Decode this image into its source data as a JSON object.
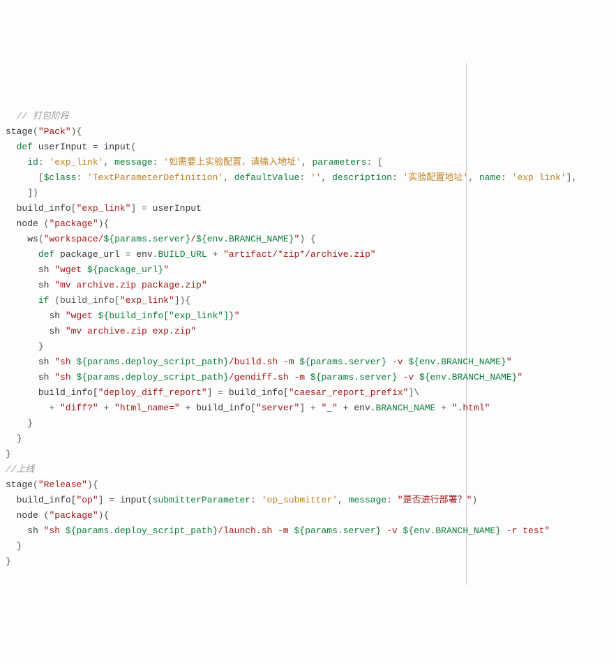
{
  "code": {
    "lines": [
      {
        "indent": 1,
        "parts": [
          {
            "t": "// 打包阶段",
            "c": "c-comment"
          }
        ]
      },
      {
        "indent": 0,
        "parts": [
          {
            "t": "stage",
            "c": "c-ident"
          },
          {
            "t": "(",
            "c": "c-punc"
          },
          {
            "t": "\"Pack\"",
            "c": "c-str"
          },
          {
            "t": "){",
            "c": "c-punc"
          }
        ]
      },
      {
        "indent": 1,
        "parts": [
          {
            "t": "def",
            "c": "c-kw"
          },
          {
            "t": " userInput ",
            "c": "c-ident"
          },
          {
            "t": "=",
            "c": "c-punc"
          },
          {
            "t": " input",
            "c": "c-ident"
          },
          {
            "t": "(",
            "c": "c-punc"
          }
        ]
      },
      {
        "indent": 2,
        "parts": [
          {
            "t": "id",
            "c": "c-param"
          },
          {
            "t": ": ",
            "c": "c-punc"
          },
          {
            "t": "'exp_link'",
            "c": "c-str2"
          },
          {
            "t": ", ",
            "c": "c-punc"
          },
          {
            "t": "message",
            "c": "c-param"
          },
          {
            "t": ": ",
            "c": "c-punc"
          },
          {
            "t": "'如需要上实验配置，请输入地址'",
            "c": "c-str2"
          },
          {
            "t": ", ",
            "c": "c-punc"
          },
          {
            "t": "parameters",
            "c": "c-param"
          },
          {
            "t": ": [",
            "c": "c-punc"
          }
        ]
      },
      {
        "indent": 3,
        "parts": [
          {
            "t": "[",
            "c": "c-punc"
          },
          {
            "t": "$class",
            "c": "c-param"
          },
          {
            "t": ": ",
            "c": "c-punc"
          },
          {
            "t": "'TextParameterDefinition'",
            "c": "c-str2"
          },
          {
            "t": ", ",
            "c": "c-punc"
          },
          {
            "t": "defaultValue",
            "c": "c-param"
          },
          {
            "t": ": ",
            "c": "c-punc"
          },
          {
            "t": "''",
            "c": "c-str2"
          },
          {
            "t": ", ",
            "c": "c-punc"
          },
          {
            "t": "description",
            "c": "c-param"
          },
          {
            "t": ": ",
            "c": "c-punc"
          },
          {
            "t": "'实验配置地址'",
            "c": "c-str2"
          },
          {
            "t": ", ",
            "c": "c-punc"
          },
          {
            "t": "name",
            "c": "c-param"
          },
          {
            "t": ": ",
            "c": "c-punc"
          },
          {
            "t": "'exp link'",
            "c": "c-str2"
          },
          {
            "t": "],",
            "c": "c-punc"
          }
        ]
      },
      {
        "indent": 2,
        "parts": [
          {
            "t": "])",
            "c": "c-punc"
          }
        ]
      },
      {
        "indent": 1,
        "parts": [
          {
            "t": "build_info",
            "c": "c-ident"
          },
          {
            "t": "[",
            "c": "c-punc"
          },
          {
            "t": "\"exp_link\"",
            "c": "c-str"
          },
          {
            "t": "] ",
            "c": "c-punc"
          },
          {
            "t": "=",
            "c": "c-punc"
          },
          {
            "t": " userInput",
            "c": "c-ident"
          }
        ]
      },
      {
        "indent": 1,
        "parts": [
          {
            "t": "node ",
            "c": "c-ident"
          },
          {
            "t": "(",
            "c": "c-punc"
          },
          {
            "t": "\"package\"",
            "c": "c-str"
          },
          {
            "t": "){",
            "c": "c-punc"
          }
        ]
      },
      {
        "indent": 2,
        "parts": [
          {
            "t": "ws",
            "c": "c-ident"
          },
          {
            "t": "(",
            "c": "c-punc"
          },
          {
            "t": "\"workspace/",
            "c": "c-str"
          },
          {
            "t": "${params.server}",
            "c": "c-interp"
          },
          {
            "t": "/",
            "c": "c-str"
          },
          {
            "t": "${env.BRANCH_NAME}",
            "c": "c-interp"
          },
          {
            "t": "\"",
            "c": "c-str"
          },
          {
            "t": ") {",
            "c": "c-punc"
          }
        ]
      },
      {
        "indent": 3,
        "parts": [
          {
            "t": "def",
            "c": "c-kw"
          },
          {
            "t": " package_url ",
            "c": "c-ident"
          },
          {
            "t": "=",
            "c": "c-punc"
          },
          {
            "t": " env",
            "c": "c-ident"
          },
          {
            "t": ".",
            "c": "c-punc"
          },
          {
            "t": "BUILD_URL",
            "c": "c-prop"
          },
          {
            "t": " + ",
            "c": "c-punc"
          },
          {
            "t": "\"artifact/*zip*/archive.zip\"",
            "c": "c-str"
          }
        ]
      },
      {
        "indent": 3,
        "parts": [
          {
            "t": "sh ",
            "c": "c-ident"
          },
          {
            "t": "\"wget ",
            "c": "c-str"
          },
          {
            "t": "${package_url}",
            "c": "c-interp"
          },
          {
            "t": "\"",
            "c": "c-str"
          }
        ]
      },
      {
        "indent": 3,
        "parts": [
          {
            "t": "sh ",
            "c": "c-ident"
          },
          {
            "t": "\"mv archive.zip package.zip\"",
            "c": "c-str"
          }
        ]
      },
      {
        "indent": 3,
        "parts": [
          {
            "t": "if",
            "c": "c-kw"
          },
          {
            "t": " (build_info[",
            "c": "c-punc"
          },
          {
            "t": "\"exp_link\"",
            "c": "c-str"
          },
          {
            "t": "]){",
            "c": "c-punc"
          }
        ]
      },
      {
        "indent": 4,
        "parts": [
          {
            "t": "sh ",
            "c": "c-ident"
          },
          {
            "t": "\"wget ",
            "c": "c-str"
          },
          {
            "t": "${build_info[\"exp_link\"]}",
            "c": "c-interp"
          },
          {
            "t": "\"",
            "c": "c-str"
          }
        ]
      },
      {
        "indent": 4,
        "parts": [
          {
            "t": "sh ",
            "c": "c-ident"
          },
          {
            "t": "\"mv archive.zip exp.zip\"",
            "c": "c-str"
          }
        ]
      },
      {
        "indent": 3,
        "parts": [
          {
            "t": "}",
            "c": "c-punc"
          }
        ]
      },
      {
        "indent": 3,
        "parts": [
          {
            "t": "sh ",
            "c": "c-ident"
          },
          {
            "t": "\"sh ",
            "c": "c-str"
          },
          {
            "t": "${params.deploy_script_path}",
            "c": "c-interp"
          },
          {
            "t": "/build.sh -m ",
            "c": "c-str"
          },
          {
            "t": "${params.server}",
            "c": "c-interp"
          },
          {
            "t": " -v ",
            "c": "c-str"
          },
          {
            "t": "${env.BRANCH_NAME}",
            "c": "c-interp"
          },
          {
            "t": "\"",
            "c": "c-str"
          }
        ]
      },
      {
        "indent": 3,
        "parts": [
          {
            "t": "sh ",
            "c": "c-ident"
          },
          {
            "t": "\"sh ",
            "c": "c-str"
          },
          {
            "t": "${params.deploy_script_path}",
            "c": "c-interp"
          },
          {
            "t": "/gendiff.sh -m ",
            "c": "c-str"
          },
          {
            "t": "${params.server}",
            "c": "c-interp"
          },
          {
            "t": " -v ",
            "c": "c-str"
          },
          {
            "t": "${env.BRANCH_NAME}",
            "c": "c-interp"
          },
          {
            "t": "\"",
            "c": "c-str"
          }
        ]
      },
      {
        "indent": 3,
        "parts": [
          {
            "t": "build_info[",
            "c": "c-ident"
          },
          {
            "t": "\"deploy_diff_report\"",
            "c": "c-str"
          },
          {
            "t": "] ",
            "c": "c-punc"
          },
          {
            "t": "=",
            "c": "c-punc"
          },
          {
            "t": " build_info[",
            "c": "c-ident"
          },
          {
            "t": "\"caesar_report_prefix\"",
            "c": "c-str"
          },
          {
            "t": "]\\",
            "c": "c-punc"
          }
        ]
      },
      {
        "indent": 4,
        "parts": [
          {
            "t": "+ ",
            "c": "c-punc"
          },
          {
            "t": "\"diff?\"",
            "c": "c-str"
          },
          {
            "t": " + ",
            "c": "c-punc"
          },
          {
            "t": "\"html_name=\"",
            "c": "c-str"
          },
          {
            "t": " + build_info[",
            "c": "c-ident"
          },
          {
            "t": "\"server\"",
            "c": "c-str"
          },
          {
            "t": "] + ",
            "c": "c-punc"
          },
          {
            "t": "\"_\"",
            "c": "c-str"
          },
          {
            "t": " + env.",
            "c": "c-ident"
          },
          {
            "t": "BRANCH_NAME",
            "c": "c-prop"
          },
          {
            "t": " + ",
            "c": "c-punc"
          },
          {
            "t": "\".html\"",
            "c": "c-str"
          }
        ]
      },
      {
        "indent": 2,
        "parts": [
          {
            "t": "}",
            "c": "c-punc"
          }
        ]
      },
      {
        "indent": 1,
        "parts": [
          {
            "t": "}",
            "c": "c-punc"
          }
        ]
      },
      {
        "indent": 0,
        "parts": [
          {
            "t": "}",
            "c": "c-punc"
          }
        ]
      },
      {
        "indent": 0,
        "parts": [
          {
            "t": "//上线",
            "c": "c-comment"
          }
        ]
      },
      {
        "indent": 0,
        "parts": [
          {
            "t": "stage",
            "c": "c-ident"
          },
          {
            "t": "(",
            "c": "c-punc"
          },
          {
            "t": "\"Release\"",
            "c": "c-str"
          },
          {
            "t": "){",
            "c": "c-punc"
          }
        ]
      },
      {
        "indent": 1,
        "parts": [
          {
            "t": "build_info[",
            "c": "c-ident"
          },
          {
            "t": "\"op\"",
            "c": "c-str"
          },
          {
            "t": "] ",
            "c": "c-punc"
          },
          {
            "t": "=",
            "c": "c-punc"
          },
          {
            "t": " input(",
            "c": "c-ident"
          },
          {
            "t": "submitterParameter",
            "c": "c-param"
          },
          {
            "t": ": ",
            "c": "c-punc"
          },
          {
            "t": "'op_submitter'",
            "c": "c-str2"
          },
          {
            "t": ", ",
            "c": "c-punc"
          },
          {
            "t": "message",
            "c": "c-param"
          },
          {
            "t": ": ",
            "c": "c-punc"
          },
          {
            "t": "\"是否进行部署？\"",
            "c": "c-str"
          },
          {
            "t": ")",
            "c": "c-punc"
          }
        ]
      },
      {
        "indent": 1,
        "parts": [
          {
            "t": "node ",
            "c": "c-ident"
          },
          {
            "t": "(",
            "c": "c-punc"
          },
          {
            "t": "\"package\"",
            "c": "c-str"
          },
          {
            "t": "){",
            "c": "c-punc"
          }
        ]
      },
      {
        "indent": 2,
        "parts": [
          {
            "t": "sh ",
            "c": "c-ident"
          },
          {
            "t": "\"sh ",
            "c": "c-str"
          },
          {
            "t": "${params.deploy_script_path}",
            "c": "c-interp"
          },
          {
            "t": "/launch.sh -m ",
            "c": "c-str"
          },
          {
            "t": "${params.server}",
            "c": "c-interp"
          },
          {
            "t": " -v ",
            "c": "c-str"
          },
          {
            "t": "${env.BRANCH_NAME}",
            "c": "c-interp"
          },
          {
            "t": " -r test\"",
            "c": "c-str"
          }
        ]
      },
      {
        "indent": 1,
        "parts": [
          {
            "t": "}",
            "c": "c-punc"
          }
        ]
      },
      {
        "indent": 0,
        "parts": [
          {
            "t": "}",
            "c": "c-punc"
          }
        ]
      }
    ]
  }
}
